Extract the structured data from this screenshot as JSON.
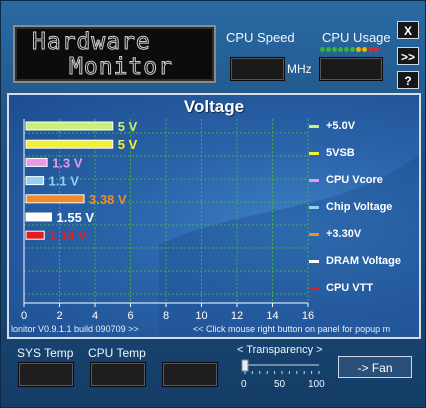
{
  "header": {
    "lcd_line1": "Hardware",
    "lcd_line2": "Monitor",
    "cpu_speed_label": "CPU Speed",
    "cpu_speed_unit": "MHz",
    "cpu_usage_label": "CPU Usage",
    "usage_dot_colors": [
      "#3fb03f",
      "#3fb03f",
      "#3fb03f",
      "#3fb03f",
      "#3fb03f",
      "#3fb03f",
      "#e6b800",
      "#e6b800",
      "#d43030",
      "#d43030"
    ]
  },
  "side_buttons": {
    "close": "X",
    "expand": ">>",
    "help": "?"
  },
  "panel": {
    "title": "Voltage",
    "footer_left": "lonitor V0.9.1.1 build 090709 >>",
    "footer_right": "<< Click mouse right button on panel for popup m"
  },
  "chart_data": {
    "type": "bar",
    "orientation": "horizontal",
    "title": "Voltage",
    "x_ticks": [
      "0",
      "2",
      "4",
      "6",
      "8",
      "10",
      "12",
      "14",
      "16"
    ],
    "xlim": [
      0,
      16
    ],
    "grid": true,
    "legend_placement": "right",
    "series": [
      {
        "name": "+5.0V",
        "value": 5.0,
        "label": "5 V",
        "color": "#c9f07a"
      },
      {
        "name": "5VSB",
        "value": 5.0,
        "label": "5 V",
        "color": "#f2ef3a"
      },
      {
        "name": "CPU Vcore",
        "value": 1.3,
        "label": "1.3 V",
        "color": "#e89ae6"
      },
      {
        "name": "Chip Voltage",
        "value": 1.1,
        "label": "1.1 V",
        "color": "#8fd3f3"
      },
      {
        "name": "+3.30V",
        "value": 3.38,
        "label": "3.38 V",
        "color": "#f08c28"
      },
      {
        "name": "DRAM Voltage",
        "value": 1.55,
        "label": "1.55 V",
        "color": "#ffffff"
      },
      {
        "name": "CPU VTT",
        "value": 1.14,
        "label": "1.14 V",
        "color": "#e02020"
      }
    ]
  },
  "bottom": {
    "sys_temp_label": "SYS Temp",
    "cpu_temp_label": "CPU Temp",
    "transparency_label": "< Transparency >",
    "slider_ticks": [
      "0",
      "50",
      "100"
    ],
    "transparency_value": 0,
    "fan_button": "-> Fan"
  }
}
